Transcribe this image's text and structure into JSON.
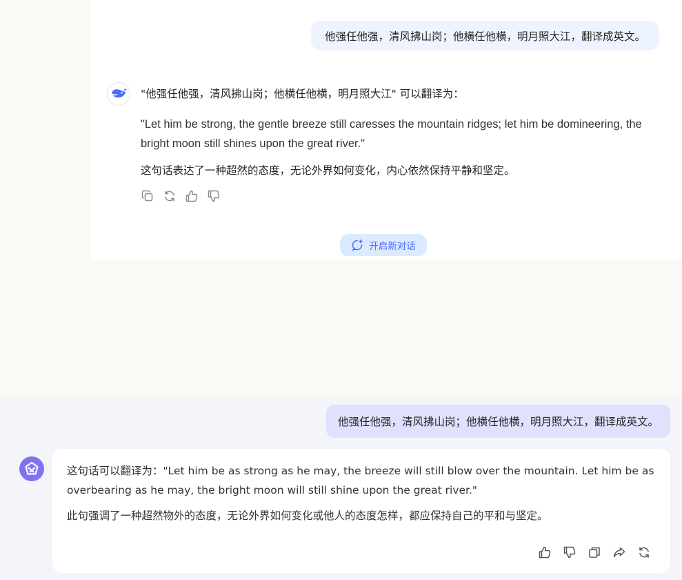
{
  "top": {
    "user_message": "他强任他强，清风拂山岗；他横任他横，明月照大江，翻译成英文。",
    "reply_intro": "\"他强任他强，清风拂山岗；他横任他横，明月照大江\" 可以翻译为：",
    "reply_quote": "\"Let him be strong, the gentle breeze still caresses the mountain ridges; let him be domineering, the bright moon still shines upon the great river.\"",
    "reply_comment": "这句话表达了一种超然的态度，无论外界如何变化，内心依然保持平静和坚定。",
    "actions": [
      "copy-icon",
      "regenerate-icon",
      "thumbs-up-icon",
      "thumbs-down-icon"
    ],
    "new_chat_label": "开启新对话",
    "accent_color": "#4d6bfe"
  },
  "bottom": {
    "user_message": "他强任他强，清风拂山岗；他横任他横，明月照大江，翻译成英文。",
    "reply_p1": "这句话可以翻译为：\"Let him be as strong as he may, the breeze will still blow over the mountain. Let him be as overbearing as he may, the bright moon will still shine upon the great river.\"",
    "reply_p2": "此句强调了一种超然物外的态度，无论外界如何变化或他人的态度怎样，都应保持自己的平和与坚定。",
    "actions": [
      "thumbs-up-icon",
      "thumbs-down-icon",
      "copy-icon",
      "share-icon",
      "regenerate-icon"
    ],
    "accent_color": "#7f73f0"
  }
}
